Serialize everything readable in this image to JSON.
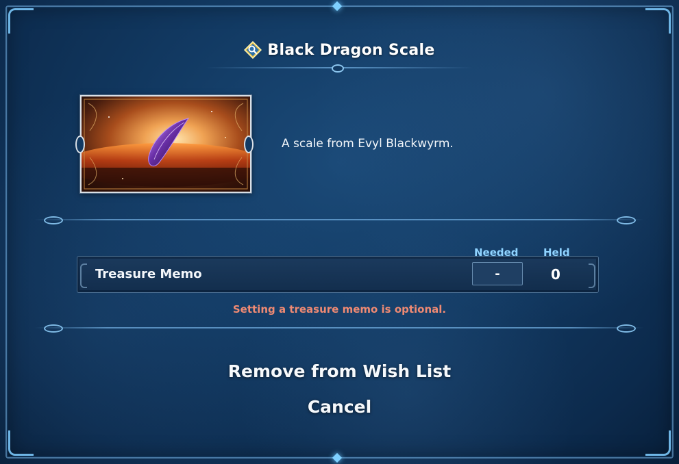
{
  "dialog": {
    "title": "Black Dragon Scale",
    "description": "A scale from Evyl Blackwyrm."
  },
  "memo": {
    "header_needed": "Needed",
    "header_held": "Held",
    "label": "Treasure Memo",
    "needed_value": "-",
    "held_value": "0",
    "note": "Setting a treasure memo is optional."
  },
  "actions": {
    "remove_label": "Remove from Wish List",
    "cancel_label": "Cancel"
  },
  "icons": {
    "title_icon": "magnifier-diamond-icon",
    "item_image": "black-dragon-scale-image"
  },
  "colors": {
    "accent": "#8fd3ff",
    "note": "#f08a73",
    "panel": "#123a63"
  }
}
